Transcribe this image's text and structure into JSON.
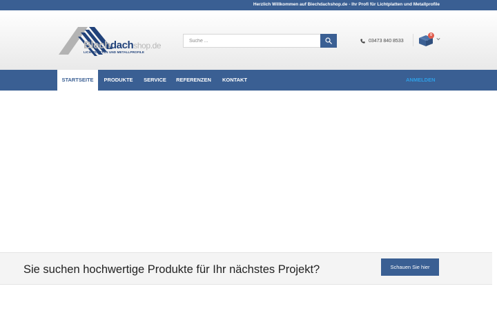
{
  "topbar": {
    "welcome_text": "Herzlich Willkommen auf Biechdachshop.de - Ihr Profi für Lichtplatten und Metallprofile"
  },
  "logo": {
    "word_part1": "Blech",
    "word_part2": "dach",
    "word_part3": "shop.de",
    "tagline": "LICHTPLATTEN UND METALLPROFILE"
  },
  "search": {
    "placeholder": "Suche ...",
    "icon": "search-icon"
  },
  "phone": {
    "number": "03473 840 8533",
    "icon": "phone-icon"
  },
  "cart": {
    "count": "0",
    "icon": "cart-box-icon"
  },
  "nav": {
    "items": [
      {
        "label": "STARTSEITE",
        "active": true
      },
      {
        "label": "PRODUKTE",
        "active": false
      },
      {
        "label": "SERVICE",
        "active": false
      },
      {
        "label": "REFERENZEN",
        "active": false
      },
      {
        "label": "KONTAKT",
        "active": false
      }
    ],
    "login_label": "ANMELDEN"
  },
  "banner": {
    "headline": "Sie suchen hochwertige Produkte für Ihr nächstes Projekt?",
    "button_label": "Schauen Sie hier"
  },
  "colors": {
    "primary": "#3a5f93",
    "login_link": "#2e9ee5",
    "badge": "#e05a4b"
  }
}
